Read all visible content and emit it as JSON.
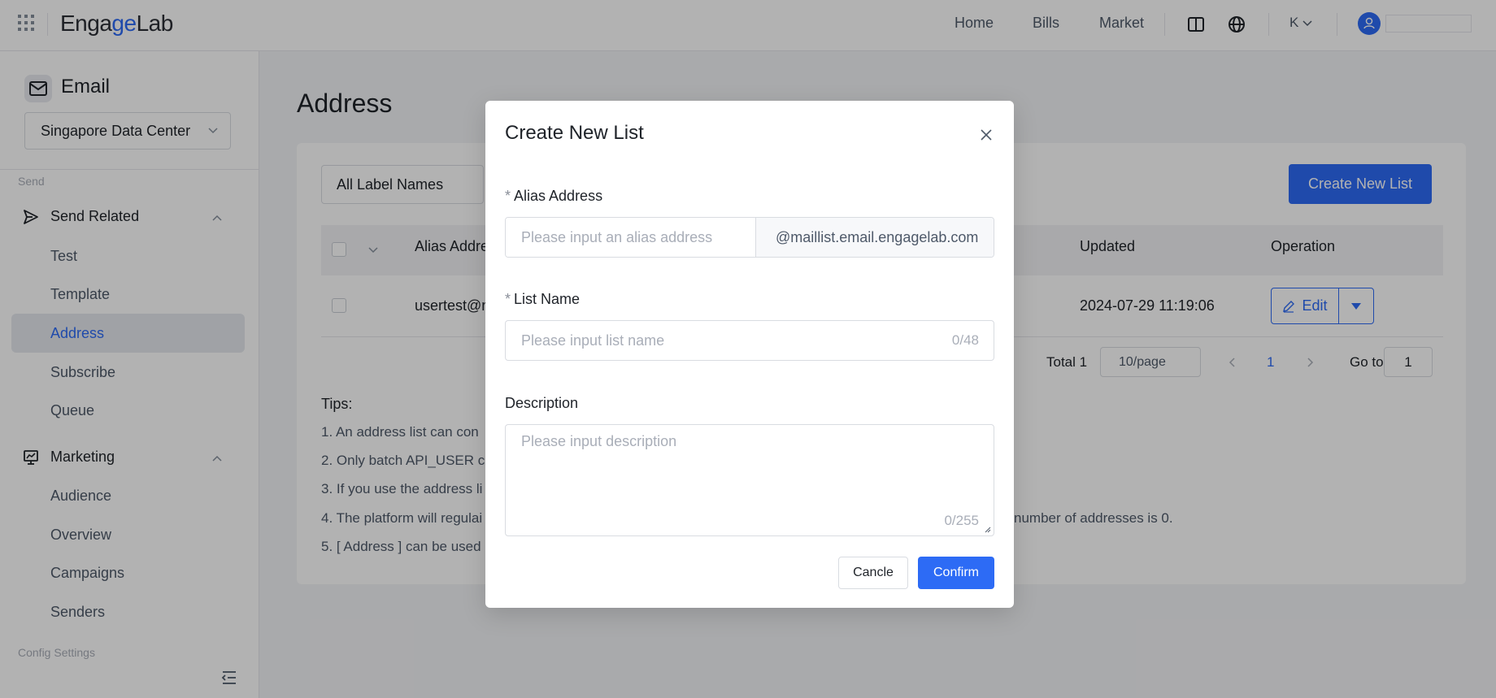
{
  "topbar": {
    "logo_prefix": "Enga",
    "logo_accent": "ge",
    "logo_suffix": "Lab",
    "nav": [
      "Home",
      "Bills",
      "Market"
    ],
    "user_initial": "K"
  },
  "sidebar": {
    "product": "Email",
    "data_center": "Singapore Data Center",
    "section_send": "Send",
    "group_send": "Send Related",
    "send_items": [
      "Test",
      "Template",
      "Address",
      "Subscribe",
      "Queue"
    ],
    "group_marketing": "Marketing",
    "marketing_items": [
      "Audience",
      "Overview",
      "Campaigns",
      "Senders"
    ],
    "section_config": "Config Settings",
    "active_item": "Address"
  },
  "main": {
    "title": "Address",
    "label_filter": "All Label Names",
    "create_button": "Create New List",
    "table": {
      "headers": [
        "Alias Addre",
        "Updated",
        "Operation"
      ],
      "row": {
        "alias": "usertest@m",
        "updated": "2024-07-29 11:19:06",
        "edit": "Edit"
      }
    },
    "pager": {
      "total": "Total 1",
      "page_size": "10/page",
      "current": "1",
      "goto_label": "Go to",
      "goto_value": "1"
    },
    "tips_title": "Tips:",
    "tips": [
      "1. An address list can con",
      "2. Only batch API_USER c",
      "3. If you use the address li",
      "4. The platform will regulai",
      "5. [ Address ] can be used"
    ],
    "tip4_tail": "number of addresses is 0."
  },
  "modal": {
    "title": "Create New List",
    "alias_label": "Alias Address",
    "alias_placeholder": "Please input an alias address",
    "alias_suffix": "@maillist.email.engagelab.com",
    "list_label": "List Name",
    "list_placeholder": "Please input list name",
    "list_counter": "0/48",
    "desc_label": "Description",
    "desc_placeholder": "Please input description",
    "desc_counter": "0/255",
    "cancel": "Cancle",
    "confirm": "Confirm",
    "required_mark": "*"
  }
}
